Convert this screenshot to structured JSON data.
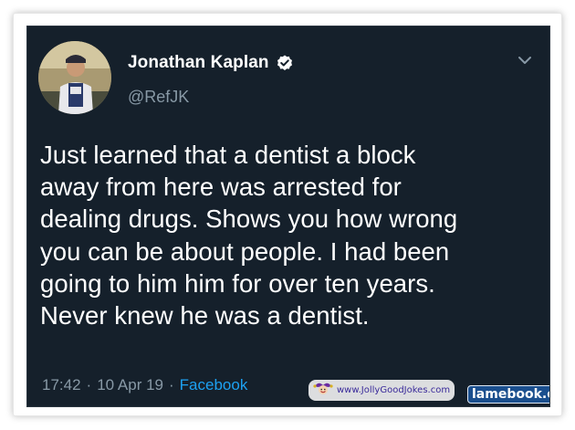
{
  "tweet": {
    "author": {
      "name": "Jonathan Kaplan",
      "handle": "@RefJK",
      "verified": true
    },
    "text_lines": [
      "Just learned that a dentist a block",
      "away from here was arrested for",
      "dealing drugs. Shows you how wrong",
      "you can be about people. I had been",
      "going to him him for over ten years.",
      "Never knew he was a dentist."
    ],
    "time": "17:42",
    "date": "10 Apr 19",
    "separator": "·",
    "source": "Facebook"
  },
  "watermarks": {
    "jollygoodjokes": "www.JollyGoodJokes.com",
    "lamebook": "lamebook.com"
  },
  "colors": {
    "background": "#15202b",
    "text": "#ffffff",
    "secondary_text": "#8899a6",
    "link": "#1da1f2",
    "verified_badge": "#ffffff"
  },
  "icons": {
    "verified": "verified-badge-icon",
    "menu": "chevron-down-icon"
  }
}
